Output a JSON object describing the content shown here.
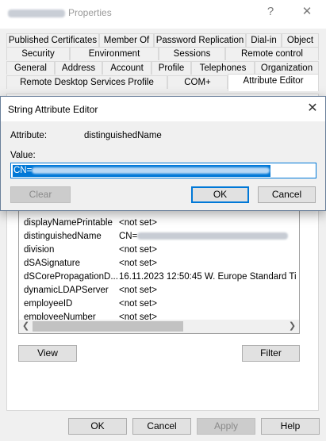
{
  "window": {
    "title": "Properties",
    "minimize_glyph": "?",
    "close_glyph": "✕"
  },
  "tabs": {
    "row1": [
      "Published Certificates",
      "Member Of",
      "Password Replication",
      "Dial-in",
      "Object"
    ],
    "row2": [
      "Security",
      "Environment",
      "Sessions",
      "Remote control"
    ],
    "row3": [
      "General",
      "Address",
      "Account",
      "Profile",
      "Telephones",
      "Organization"
    ],
    "row4": [
      "Remote Desktop Services Profile",
      "COM+",
      "Attribute Editor"
    ]
  },
  "attributes": [
    {
      "name": "displayNamePrintable",
      "value": "<not set>"
    },
    {
      "name": "distinguishedName",
      "value": "CN="
    },
    {
      "name": "division",
      "value": "<not set>"
    },
    {
      "name": "dSASignature",
      "value": "<not set>"
    },
    {
      "name": "dSCorePropagationD...",
      "value": "16.11.2023 12:50:45 W. Europe Standard Ti"
    },
    {
      "name": "dynamicLDAPServer",
      "value": "<not set>"
    },
    {
      "name": "employeeID",
      "value": "<not set>"
    },
    {
      "name": "employeeNumber",
      "value": "<not set>"
    }
  ],
  "buttons": {
    "view": "View",
    "filter": "Filter",
    "ok": "OK",
    "cancel": "Cancel",
    "apply": "Apply",
    "help": "Help"
  },
  "dialog": {
    "title": "String Attribute Editor",
    "close_glyph": "✕",
    "attribute_label": "Attribute:",
    "attribute_value": "distinguishedName",
    "value_label": "Value:",
    "value_prefix": "CN=",
    "clear": "Clear",
    "ok": "OK",
    "cancel": "Cancel"
  },
  "colors": {
    "accent": "#0078d7",
    "window_bg": "#f0f0f0"
  }
}
